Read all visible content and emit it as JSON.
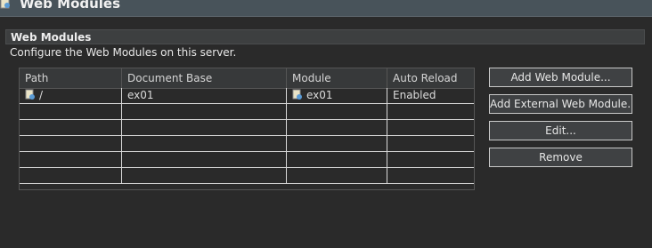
{
  "window": {
    "title": "Web Modules"
  },
  "section": {
    "title": "Web Modules",
    "description": "Configure the Web Modules on this server."
  },
  "table": {
    "columns": [
      "Path",
      "Document Base",
      "Module",
      "Auto Reload"
    ],
    "rows": [
      {
        "path": "/",
        "document_base": "ex01",
        "module": "ex01",
        "auto_reload": "Enabled",
        "path_icon": "web-module-icon",
        "module_icon": "web-module-icon"
      }
    ]
  },
  "buttons": {
    "add": "Add Web Module...",
    "add_external": "Add External Web Module...",
    "edit": "Edit...",
    "remove": "Remove"
  }
}
